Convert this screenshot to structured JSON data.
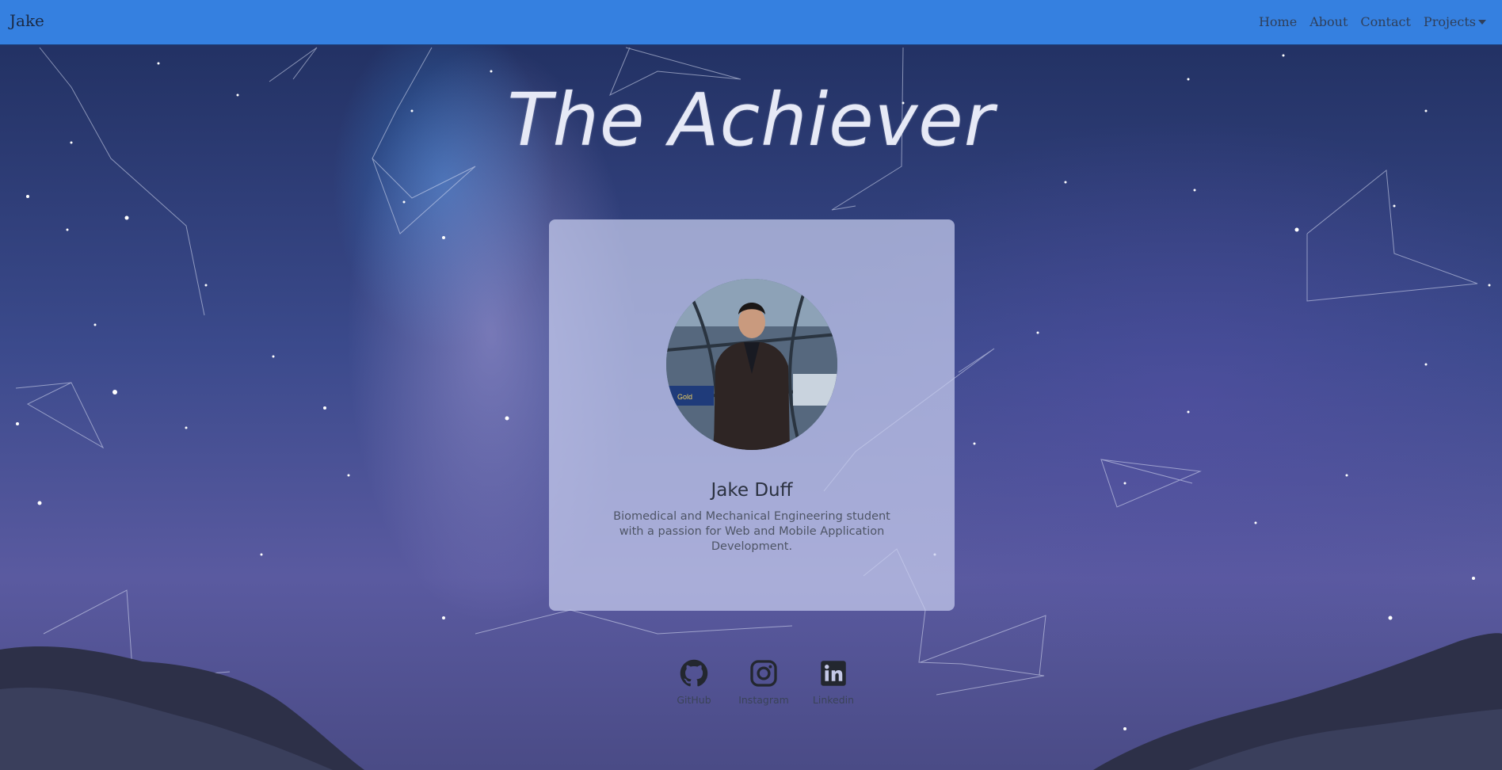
{
  "navbar": {
    "brand": "Jake",
    "links": [
      {
        "label": "Home"
      },
      {
        "label": "About"
      },
      {
        "label": "Contact"
      },
      {
        "label": "Projects",
        "icon": "caret-down-icon"
      }
    ],
    "color": "#3580e0"
  },
  "hero": {
    "title": "The Achiever"
  },
  "profile": {
    "name": "Jake Duff",
    "description": "Biomedical and Mechanical Engineering student with a passion for Web and Mobile Application Development.",
    "avatar_icon": "profile-photo",
    "photo_sign": "Gold"
  },
  "socials": [
    {
      "label": "GitHub",
      "icon": "github-icon"
    },
    {
      "label": "Instagram",
      "icon": "instagram-icon"
    },
    {
      "label": "Linkedin",
      "icon": "linkedin-icon"
    }
  ]
}
